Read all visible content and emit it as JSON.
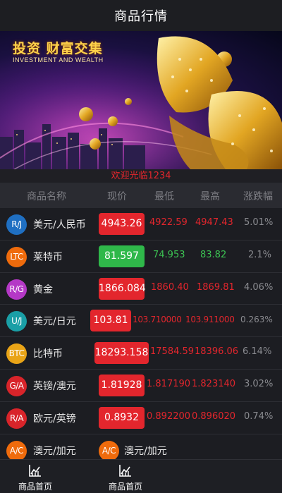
{
  "header": {
    "title": "商品行情"
  },
  "banner": {
    "headline": "投资 财富交集",
    "subhead": "INVESTMENT AND WEALTH"
  },
  "welcome": "欢迎光临1234",
  "columns": [
    "商品名称",
    "现价",
    "最低",
    "最高",
    "涨跌幅"
  ],
  "rows": [
    {
      "code": "R/J",
      "badge_color": "#1f6fc2",
      "name": "美元/人民币",
      "price": "4943.26",
      "trend": "up",
      "low": "4922.59",
      "high": "4947.43",
      "change": "5.01%"
    },
    {
      "code": "LTC",
      "badge_color": "#ef6b0c",
      "name": "莱特币",
      "price": "81.597",
      "trend": "down",
      "low": "74.953",
      "high": "83.82",
      "change": "2.1%"
    },
    {
      "code": "R/G",
      "badge_color": "#b438c6",
      "name": "黄金",
      "price": "1866.084",
      "trend": "up",
      "low": "1860.40",
      "high": "1869.81",
      "change": "4.06%"
    },
    {
      "code": "U/J",
      "badge_color": "#1a9fa6",
      "name": "美元/日元",
      "price": "103.81",
      "trend": "up",
      "low": "103.710000",
      "high": "103.911000",
      "change": "0.263%"
    },
    {
      "code": "BTC",
      "badge_color": "#e9a417",
      "name": "比特币",
      "price": "18293.158",
      "trend": "up",
      "low": "17584.59",
      "high": "18396.06",
      "change": "6.14%"
    },
    {
      "code": "G/A",
      "badge_color": "#d8242a",
      "name": "英镑/澳元",
      "price": "1.81928",
      "trend": "up",
      "low": "1.817190",
      "high": "1.823140",
      "change": "3.02%"
    },
    {
      "code": "R/A",
      "badge_color": "#d8242a",
      "name": "欧元/英镑",
      "price": "0.8932",
      "trend": "up",
      "low": "0.892200",
      "high": "0.896020",
      "change": "0.74%"
    },
    {
      "code": "A/C",
      "badge_color": "#ef6b0c",
      "name": "澳元/加元",
      "price": "",
      "trend": "up",
      "low": "",
      "high": "",
      "change": ""
    }
  ],
  "tabbar": [
    {
      "label": "商品首页",
      "icon": "chart-icon"
    },
    {
      "label": "商品首页",
      "icon": "chart-icon"
    }
  ],
  "colors": {
    "up": "#e3262d",
    "down": "#2fb84a",
    "accent_text": "#e3262d"
  }
}
